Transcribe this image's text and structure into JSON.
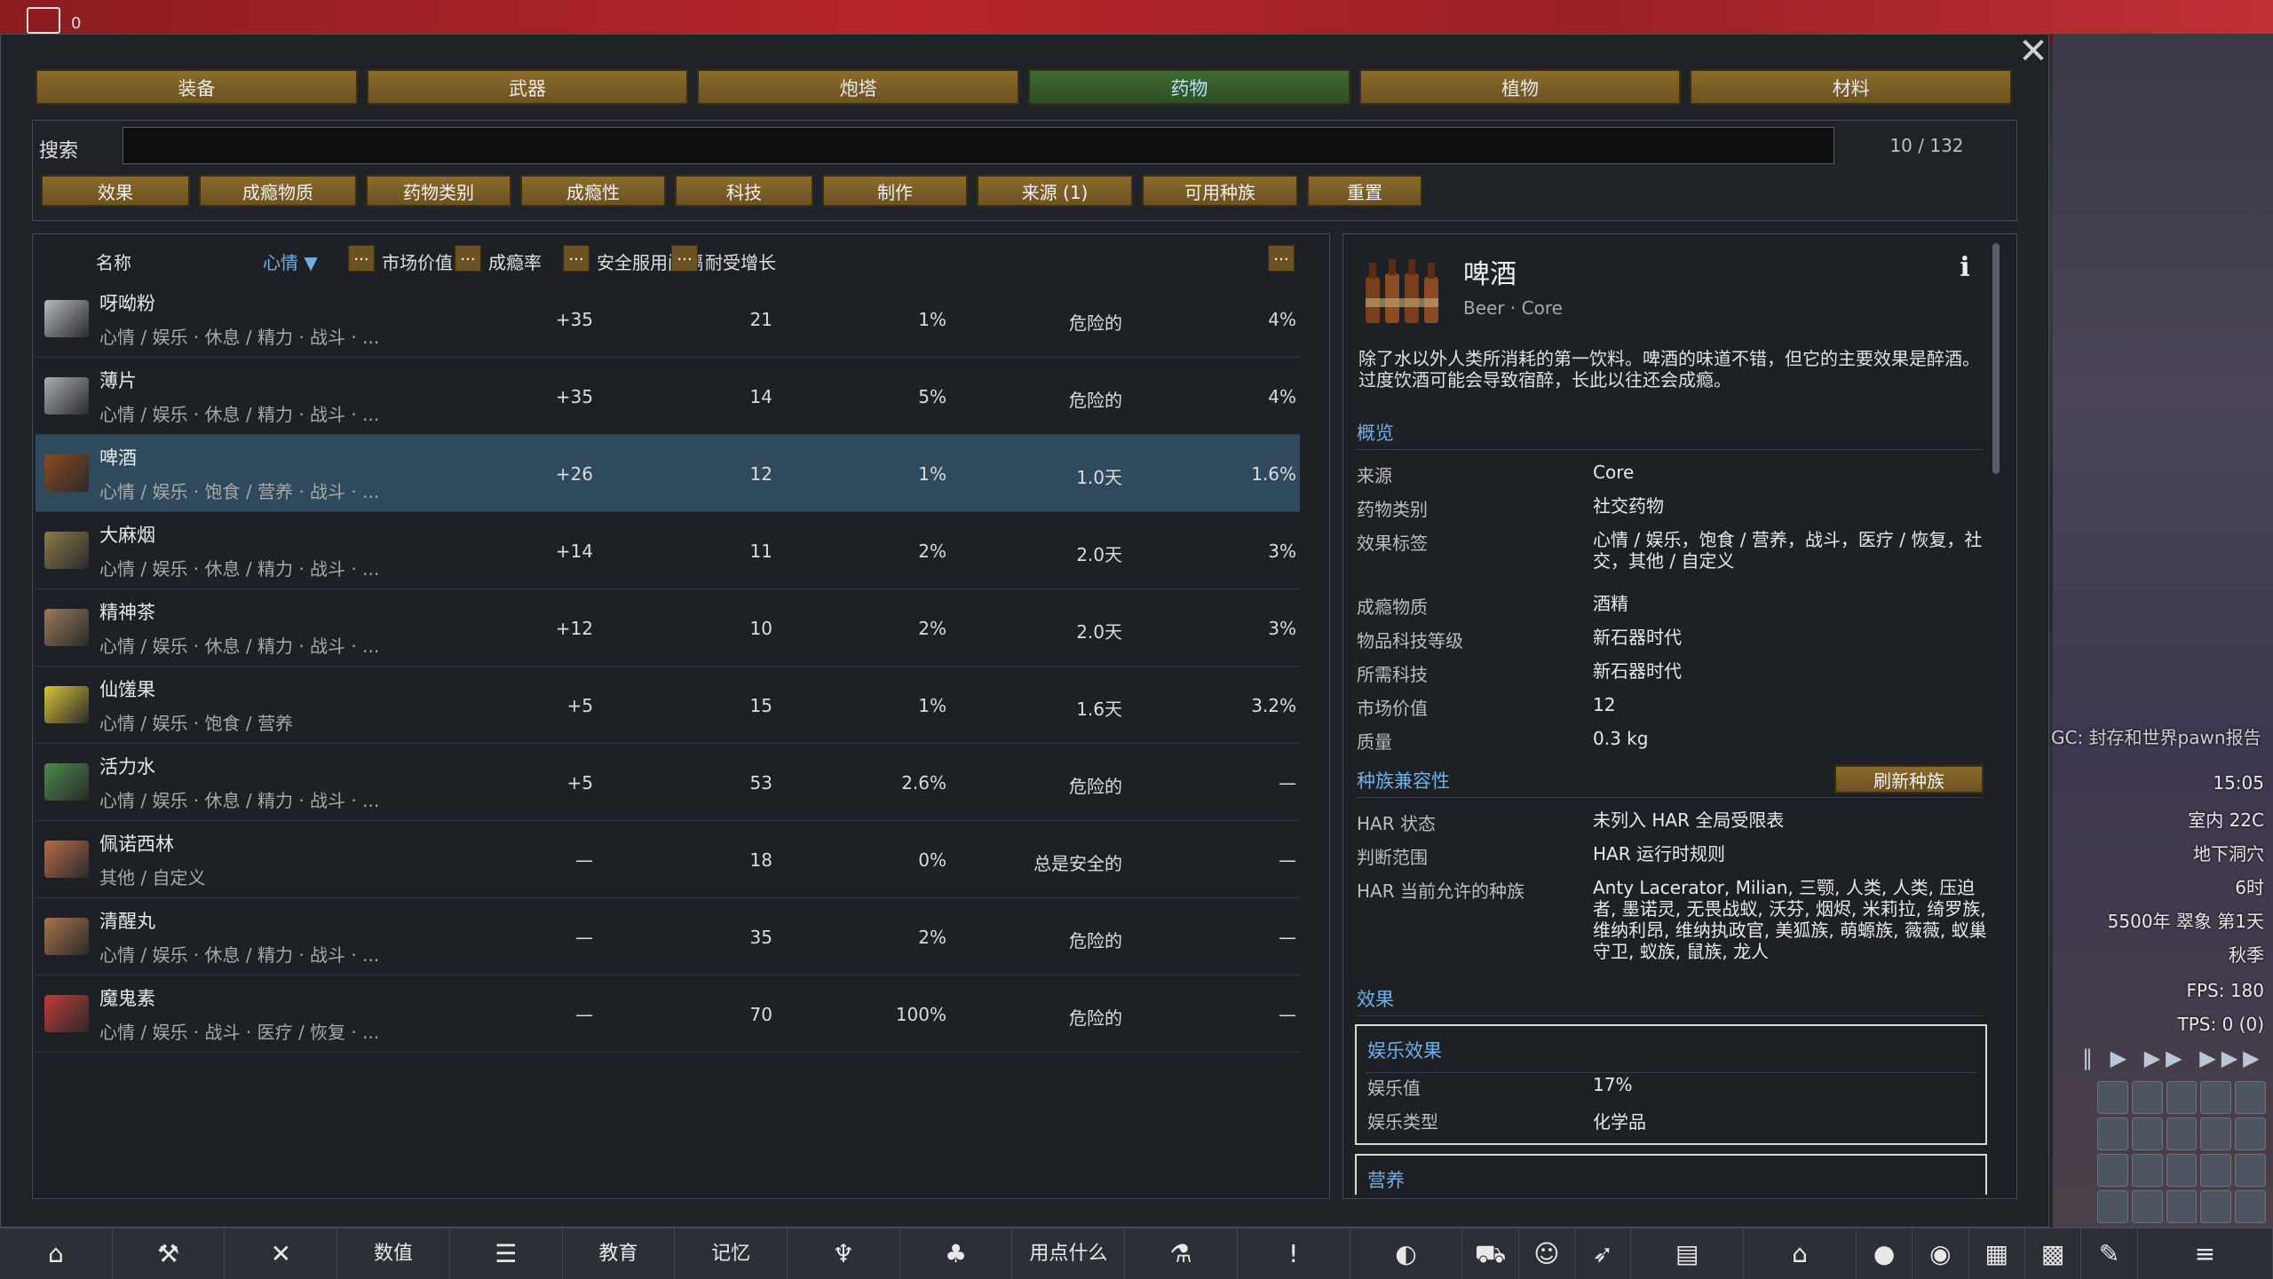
{
  "topbar": {
    "indicator_value": "0"
  },
  "category_tabs": [
    {
      "label": "装备",
      "active": false
    },
    {
      "label": "武器",
      "active": false
    },
    {
      "label": "炮塔",
      "active": false
    },
    {
      "label": "药物",
      "active": true
    },
    {
      "label": "植物",
      "active": false
    },
    {
      "label": "材料",
      "active": false
    }
  ],
  "search": {
    "label": "搜索",
    "value": "",
    "count": "10 / 132"
  },
  "filter_buttons": [
    "效果",
    "成瘾物质",
    "药物类别",
    "成瘾性",
    "科技",
    "制作",
    "来源 (1)",
    "可用种族",
    "重置"
  ],
  "list": {
    "headers": {
      "name": "名称",
      "mood": "心情 ▼",
      "market": "市场价值",
      "addiction": "成瘾率",
      "interval": "安全服用间隔",
      "tolerance": "耐受增长",
      "dots": "..."
    },
    "rows": [
      {
        "name": "呀呦粉",
        "tags": "心情 / 娱乐 · 休息 / 精力 · 战斗 · ...",
        "mood": "+35",
        "market": "21",
        "addiction": "1%",
        "interval": "危险的",
        "tolerance": "4%",
        "icon": "yayo-icon",
        "color": "#b5b8be",
        "selected": false
      },
      {
        "name": "薄片",
        "tags": "心情 / 娱乐 · 休息 / 精力 · 战斗 · ...",
        "mood": "+35",
        "market": "14",
        "addiction": "5%",
        "interval": "危险的",
        "tolerance": "4%",
        "icon": "flake-icon",
        "color": "#a9acb2",
        "selected": false
      },
      {
        "name": "啤酒",
        "tags": "心情 / 娱乐 · 饱食 / 营养 · 战斗 · ...",
        "mood": "+26",
        "market": "12",
        "addiction": "1%",
        "interval": "1.0天",
        "tolerance": "1.6%",
        "icon": "beer-icon",
        "color": "#8a4a22",
        "selected": true
      },
      {
        "name": "大麻烟",
        "tags": "心情 / 娱乐 · 休息 / 精力 · 战斗 · ...",
        "mood": "+14",
        "market": "11",
        "addiction": "2%",
        "interval": "2.0天",
        "tolerance": "3%",
        "icon": "smokeleaf-icon",
        "color": "#8c7a4a",
        "selected": false
      },
      {
        "name": "精神茶",
        "tags": "心情 / 娱乐 · 休息 / 精力 · 战斗 · ...",
        "mood": "+12",
        "market": "10",
        "addiction": "2%",
        "interval": "2.0天",
        "tolerance": "3%",
        "icon": "tea-icon",
        "color": "#9a7a5a",
        "selected": false
      },
      {
        "name": "仙馐果",
        "tags": "心情 / 娱乐 · 饱食 / 营养",
        "mood": "+5",
        "market": "15",
        "addiction": "1%",
        "interval": "1.6天",
        "tolerance": "3.2%",
        "icon": "ambrosia-icon",
        "color": "#d8c43a",
        "selected": false
      },
      {
        "name": "活力水",
        "tags": "心情 / 娱乐 · 休息 / 精力 · 战斗 · ...",
        "mood": "+5",
        "market": "53",
        "addiction": "2.6%",
        "interval": "危险的",
        "tolerance": "—",
        "icon": "go-juice-icon",
        "color": "#4a8a4a",
        "selected": false
      },
      {
        "name": "佩诺西林",
        "tags": "其他 / 自定义",
        "mood": "—",
        "market": "18",
        "addiction": "0%",
        "interval": "总是安全的",
        "tolerance": "—",
        "icon": "penoxycyline-icon",
        "color": "#b86a4a",
        "selected": false
      },
      {
        "name": "清醒丸",
        "tags": "心情 / 娱乐 · 休息 / 精力 · 战斗 · ...",
        "mood": "—",
        "market": "35",
        "addiction": "2%",
        "interval": "危险的",
        "tolerance": "—",
        "icon": "wake-up-icon",
        "color": "#a8744a",
        "selected": false
      },
      {
        "name": "魔鬼素",
        "tags": "心情 / 娱乐 · 战斗 · 医疗 / 恢复 · ...",
        "mood": "—",
        "market": "70",
        "addiction": "100%",
        "interval": "危险的",
        "tolerance": "—",
        "icon": "luciferium-icon",
        "color": "#c23a3a",
        "selected": false
      }
    ]
  },
  "detail": {
    "title": "啤酒",
    "subtitle": "Beer · Core",
    "info_icon": "i",
    "description": "除了水以外人类所消耗的第一饮料。啤酒的味道不错，但它的主要效果是醉酒。过度饮酒可能会导致宿醉，长此以往还会成瘾。",
    "overview_title": "概览",
    "overview": [
      {
        "k": "来源",
        "v": "Core"
      },
      {
        "k": "药物类别",
        "v": "社交药物"
      },
      {
        "k": "效果标签",
        "v": "心情 / 娱乐，饱食 / 营养，战斗，医疗 / 恢复，社交，其他 / 自定义"
      },
      {
        "k": "成瘾物质",
        "v": "酒精"
      },
      {
        "k": "物品科技等级",
        "v": "新石器时代"
      },
      {
        "k": "所需科技",
        "v": "新石器时代"
      },
      {
        "k": "市场价值",
        "v": "12"
      },
      {
        "k": "质量",
        "v": "0.3 kg"
      }
    ],
    "race_title": "种族兼容性",
    "refresh_label": "刷新种族",
    "race": [
      {
        "k": "HAR 状态",
        "v": "未列入 HAR 全局受限表"
      },
      {
        "k": "判断范围",
        "v": "HAR 运行时规则"
      },
      {
        "k": "HAR 当前允许的种族",
        "v": "Anty Lacerator, Milian, 三颚, 人类, 人类, 压迫者, 墨诺灵, 无畏战蚁, 沃芬, 烟烬, 米莉拉, 绮罗族, 维纳利昂, 维纳执政官, 美狐族, 萌螈族, 薇薇, 蚁巢守卫, 蚁族, 鼠族, 龙人"
      }
    ],
    "effects_title": "效果",
    "joy": {
      "title": "娱乐效果",
      "rows": [
        {
          "k": "娱乐值",
          "v": "17%"
        },
        {
          "k": "娱乐类型",
          "v": "化学品"
        }
      ]
    },
    "nutrition_title": "营养"
  },
  "world": {
    "gc_note": "GC: 封存和世界pawn报告",
    "time": "15:05",
    "temperature": "室内 22C",
    "location": "地下洞穴",
    "hour": "6时",
    "date": "5500年 翠象 第1天",
    "season": "秋季",
    "fps": "FPS: 180",
    "tps": "TPS: 0 (0)"
  },
  "bottombar": [
    {
      "label": "",
      "icon": "home-icon",
      "glyph": "⌂"
    },
    {
      "label": "",
      "icon": "hammer-icon",
      "glyph": "⚒"
    },
    {
      "label": "",
      "icon": "crossed-tools-icon",
      "glyph": "✕"
    },
    {
      "label": "数值",
      "icon": "",
      "glyph": ""
    },
    {
      "label": "",
      "icon": "list-icon",
      "glyph": "☰"
    },
    {
      "label": "教育",
      "icon": "",
      "glyph": ""
    },
    {
      "label": "记忆",
      "icon": "",
      "glyph": ""
    },
    {
      "label": "",
      "icon": "goblet-icon",
      "glyph": "♆"
    },
    {
      "label": "",
      "icon": "tree-icon",
      "glyph": "♣"
    },
    {
      "label": "用点什么",
      "icon": "",
      "glyph": ""
    },
    {
      "label": "",
      "icon": "flask-icon",
      "glyph": "⚗"
    },
    {
      "label": "",
      "icon": "alert-icon",
      "glyph": "!"
    },
    {
      "label": "",
      "icon": "world-icon",
      "glyph": "◐"
    },
    {
      "label": "",
      "icon": "cart-icon",
      "glyph": "⛟"
    },
    {
      "label": "",
      "icon": "pawn-icon",
      "glyph": "☺"
    },
    {
      "label": "",
      "icon": "rocket-icon",
      "glyph": "➶"
    },
    {
      "label": "",
      "icon": "book-icon",
      "glyph": "▤"
    },
    {
      "label": "",
      "icon": "factions-icon",
      "glyph": "⌂"
    },
    {
      "label": "",
      "icon": "lightbulb-icon",
      "glyph": "●"
    },
    {
      "label": "",
      "icon": "head-icon",
      "glyph": "◉"
    },
    {
      "label": "",
      "icon": "menu-grid-icon",
      "glyph": "▦"
    },
    {
      "label": "",
      "icon": "storage-icon",
      "glyph": "▩"
    },
    {
      "label": "",
      "icon": "edit-icon",
      "glyph": "✎"
    },
    {
      "label": "",
      "icon": "main-menu-icon",
      "glyph": "≡"
    }
  ]
}
